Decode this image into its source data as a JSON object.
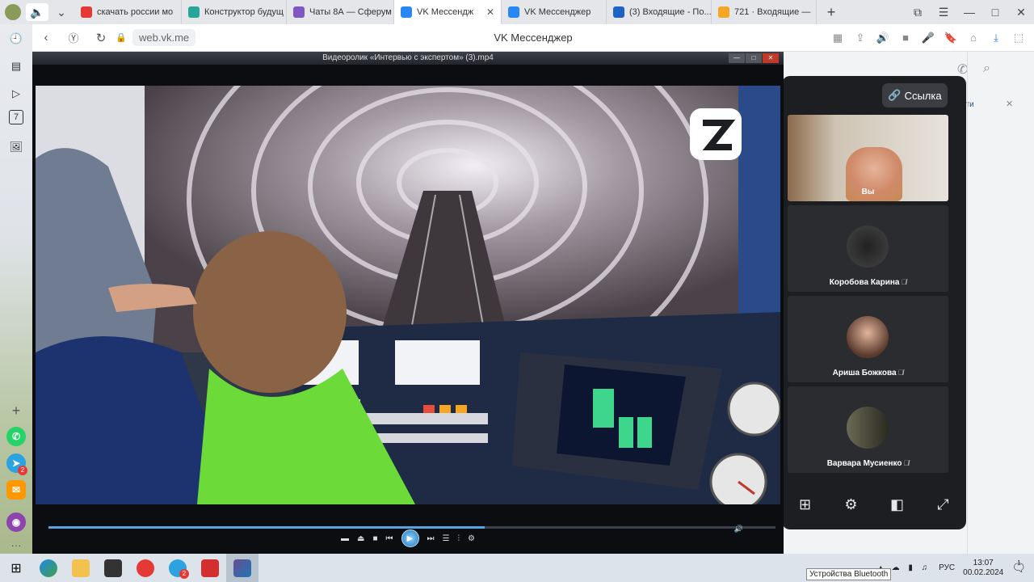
{
  "tabs": [
    {
      "label": "скачать россии мо",
      "color": "#e53935"
    },
    {
      "label": "Конструктор будущ",
      "color": "#26a69a"
    },
    {
      "label": "Чаты 8А — Сферум",
      "color": "#7e57c2"
    },
    {
      "label": "VK Мессендж",
      "color": "#2787f5",
      "active": true
    },
    {
      "label": "VK Мессенджер",
      "color": "#2787f5"
    },
    {
      "label": "(3) Входящие - По...",
      "color": "#1e63c4"
    },
    {
      "label": "721 · Входящие —",
      "color": "#f5a623"
    }
  ],
  "address": {
    "url": "web.vk.me",
    "page_title": "VK Мессенджер"
  },
  "sidebar": {
    "badge_count": "2",
    "calendar_day": "7"
  },
  "player": {
    "title": "Видеоролик «Интервью с экспертом» (3).mp4",
    "progress": 0.6
  },
  "call": {
    "link_label": "Ссылка",
    "self_label": "Вы",
    "participants": [
      {
        "name": "Коробова Карина"
      },
      {
        "name": "Ариша Божкова"
      },
      {
        "name": "Варвара Мусиенко"
      }
    ]
  },
  "vk_page": {
    "join_fragment": "йти"
  },
  "taskbar": {
    "telegram_badge": "2",
    "lang": "РУС",
    "time": "13:07",
    "date": "00.02.2024",
    "tooltip": "Устройства Bluetooth",
    "notif_count": "1"
  }
}
